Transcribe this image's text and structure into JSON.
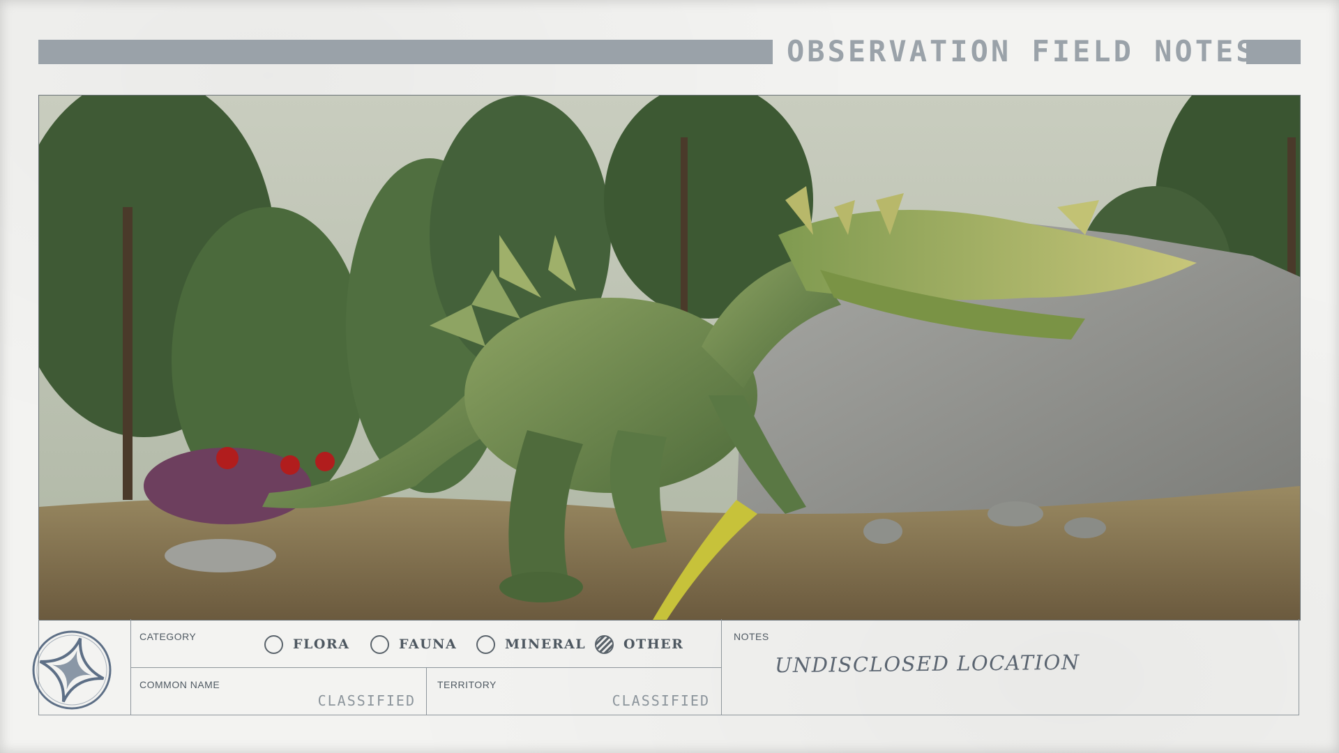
{
  "header": {
    "title": "OBSERVATION FIELD NOTES"
  },
  "category": {
    "label": "CATEGORY",
    "options": [
      {
        "label": "FLORA",
        "selected": false
      },
      {
        "label": "FAUNA",
        "selected": false
      },
      {
        "label": "MINERAL",
        "selected": false
      },
      {
        "label": "OTHER",
        "selected": true
      }
    ]
  },
  "common_name": {
    "label": "COMMON NAME",
    "value": "CLASSIFIED"
  },
  "territory": {
    "label": "TERRITORY",
    "value": "CLASSIFIED"
  },
  "notes": {
    "label": "NOTES",
    "value": "UNDISCLOSED LOCATION"
  },
  "colors": {
    "header_bar": "#9aa2a9",
    "ink": "#4d5760",
    "paper": "#f3f3f1",
    "creature": "#6f8a52"
  },
  "icons": [
    "star-compass-emblem-icon"
  ]
}
